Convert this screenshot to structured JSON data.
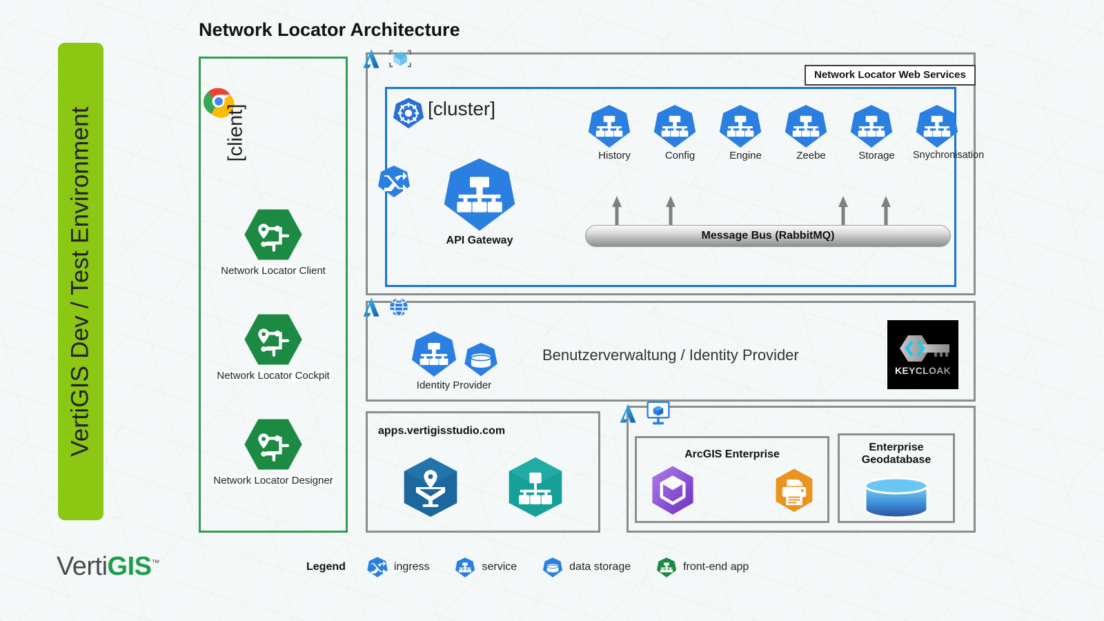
{
  "page": {
    "title": "Network Locator Architecture",
    "background": "#f5f8f8"
  },
  "environment": {
    "label": "VertiGIS Dev / Test Environment",
    "color": "#8CC713"
  },
  "client": {
    "label": "[client]",
    "browser_icon": "chrome-icon",
    "border_color": "#2e9e4f",
    "apps": [
      {
        "label": "Network Locator Client",
        "icon": "network-locator-hexagon-icon",
        "color": "#1d8a43"
      },
      {
        "label": "Network Locator Cockpit",
        "icon": "network-locator-hexagon-icon",
        "color": "#1d8a43"
      },
      {
        "label": "Network Locator Designer",
        "icon": "network-locator-hexagon-icon",
        "color": "#1d8a43"
      }
    ]
  },
  "aks": {
    "azure_badge": "azure-logo",
    "service_icon": "aks-cube-icon",
    "web_services_badge": "Network Locator Web Services",
    "cluster": {
      "label": "[cluster]",
      "icon": "kubernetes-helm-icon",
      "ingress_icon": "ingress-icon",
      "border_color": "#1673d6",
      "api_gateway": {
        "label": "API Gateway",
        "icon": "kubernetes-service-icon"
      },
      "services": [
        {
          "label": "History",
          "icon": "kubernetes-service-icon"
        },
        {
          "label": "Config",
          "icon": "kubernetes-service-icon"
        },
        {
          "label": "Engine",
          "icon": "kubernetes-service-icon"
        },
        {
          "label": "Zeebe",
          "icon": "kubernetes-service-icon"
        },
        {
          "label": "Storage",
          "icon": "kubernetes-service-icon"
        },
        {
          "label": "Snychronisation",
          "icon": "kubernetes-service-icon"
        }
      ],
      "message_bus": {
        "label": "Message Bus (RabbitMQ)",
        "arrow_count": 4
      }
    }
  },
  "identity": {
    "azure_badge": "azure-logo",
    "service_icon": "azure-network-globe-icon",
    "title": "Benutzerverwaltung / Identity Provider",
    "node_label": "Identity Provider",
    "node_icons": [
      "kubernetes-service-icon",
      "data-storage-icon"
    ],
    "vendor": {
      "name": "KEYCLOAK",
      "icon": "keycloak-key-icon",
      "background": "#000000"
    }
  },
  "studio": {
    "title": "apps.vertigisstudio.com",
    "icons": [
      {
        "name": "vertigis-studio-map-hexagon-icon",
        "color": "#1b679e"
      },
      {
        "name": "vertigis-studio-service-hexagon-icon",
        "color": "#16a09a"
      }
    ]
  },
  "onprem": {
    "azure_badge": "azure-logo",
    "service_icon": "azure-virtual-machine-icon",
    "arcgis": {
      "title": "ArcGIS Enterprise",
      "icons": [
        {
          "name": "arcgis-enterprise-hexagon-icon",
          "color": "#8a4fd6"
        },
        {
          "name": "print-service-hexagon-icon",
          "color": "#e8941f"
        }
      ]
    },
    "geodatabase": {
      "title": "Enterprise\nGeodatabase",
      "title_line1": "Enterprise",
      "title_line2": "Geodatabase",
      "icon": "database-cylinder-icon"
    }
  },
  "footer": {
    "brand": {
      "part1": "Verti",
      "part2": "GIS",
      "tm": "™"
    },
    "legend": {
      "title": "Legend",
      "items": [
        {
          "label": "ingress",
          "icon": "ingress-icon",
          "color": "#2a7fe0"
        },
        {
          "label": "service",
          "icon": "kubernetes-service-icon",
          "color": "#2a7fe0"
        },
        {
          "label": "data storage",
          "icon": "data-storage-icon",
          "color": "#2a7fe0"
        },
        {
          "label": "front-end app",
          "icon": "front-end-app-icon",
          "color": "#1d8a43"
        }
      ]
    }
  }
}
